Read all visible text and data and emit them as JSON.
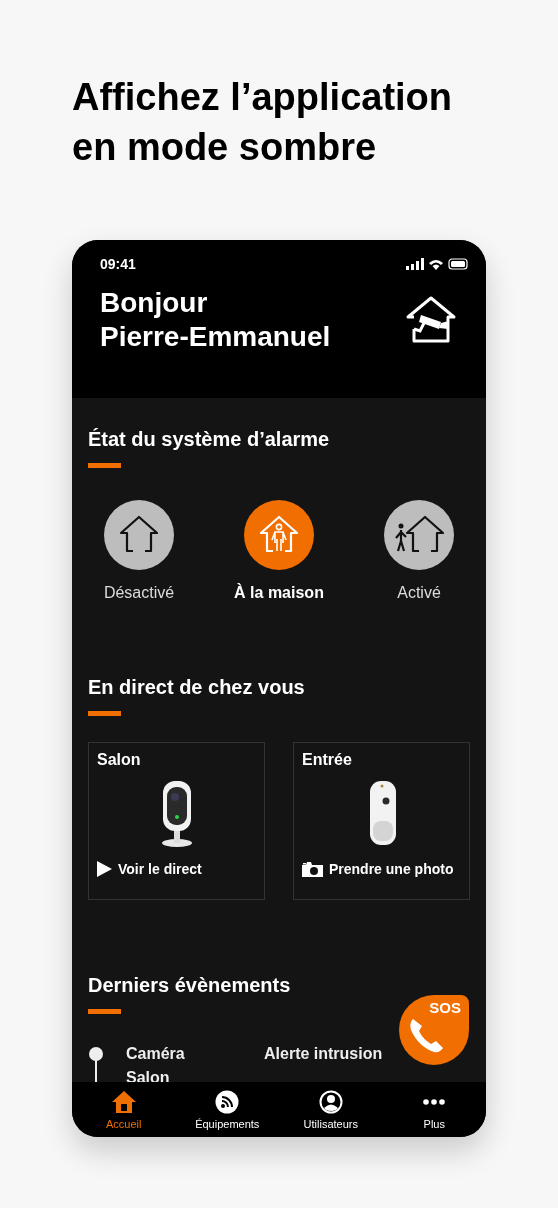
{
  "headline": "Affichez l’application en mode sombre",
  "status_bar": {
    "time": "09:41"
  },
  "header": {
    "greeting": "Bonjour",
    "name": "Pierre-Emmanuel"
  },
  "alarm": {
    "title": "État du système d’alarme",
    "modes": [
      {
        "kind": "off",
        "label": "Désactivé",
        "selected": false
      },
      {
        "kind": "home",
        "label": "À la maison",
        "selected": true
      },
      {
        "kind": "armed",
        "label": "Activé",
        "selected": false
      }
    ]
  },
  "live": {
    "title": "En direct de chez vous",
    "cameras": [
      {
        "kind": "camera",
        "room": "Salon",
        "action": {
          "kind": "play",
          "label": "Voir le direct"
        }
      },
      {
        "kind": "sensor",
        "room": "Entrée",
        "action": {
          "label": "Prendre une photo"
        }
      }
    ]
  },
  "events": {
    "title": "Derniers évènements",
    "items": [
      {
        "device": "Caméra Salon",
        "message": "Alerte intrusion"
      }
    ]
  },
  "sos": {
    "label": "SOS"
  },
  "nav": [
    {
      "kind": "home",
      "label": "Accueil",
      "selected": true
    },
    {
      "kind": "devices",
      "label": "Équipements",
      "selected": false
    },
    {
      "kind": "users",
      "label": "Utilisateurs",
      "selected": false
    },
    {
      "kind": "more",
      "label": "Plus",
      "selected": false
    }
  ]
}
